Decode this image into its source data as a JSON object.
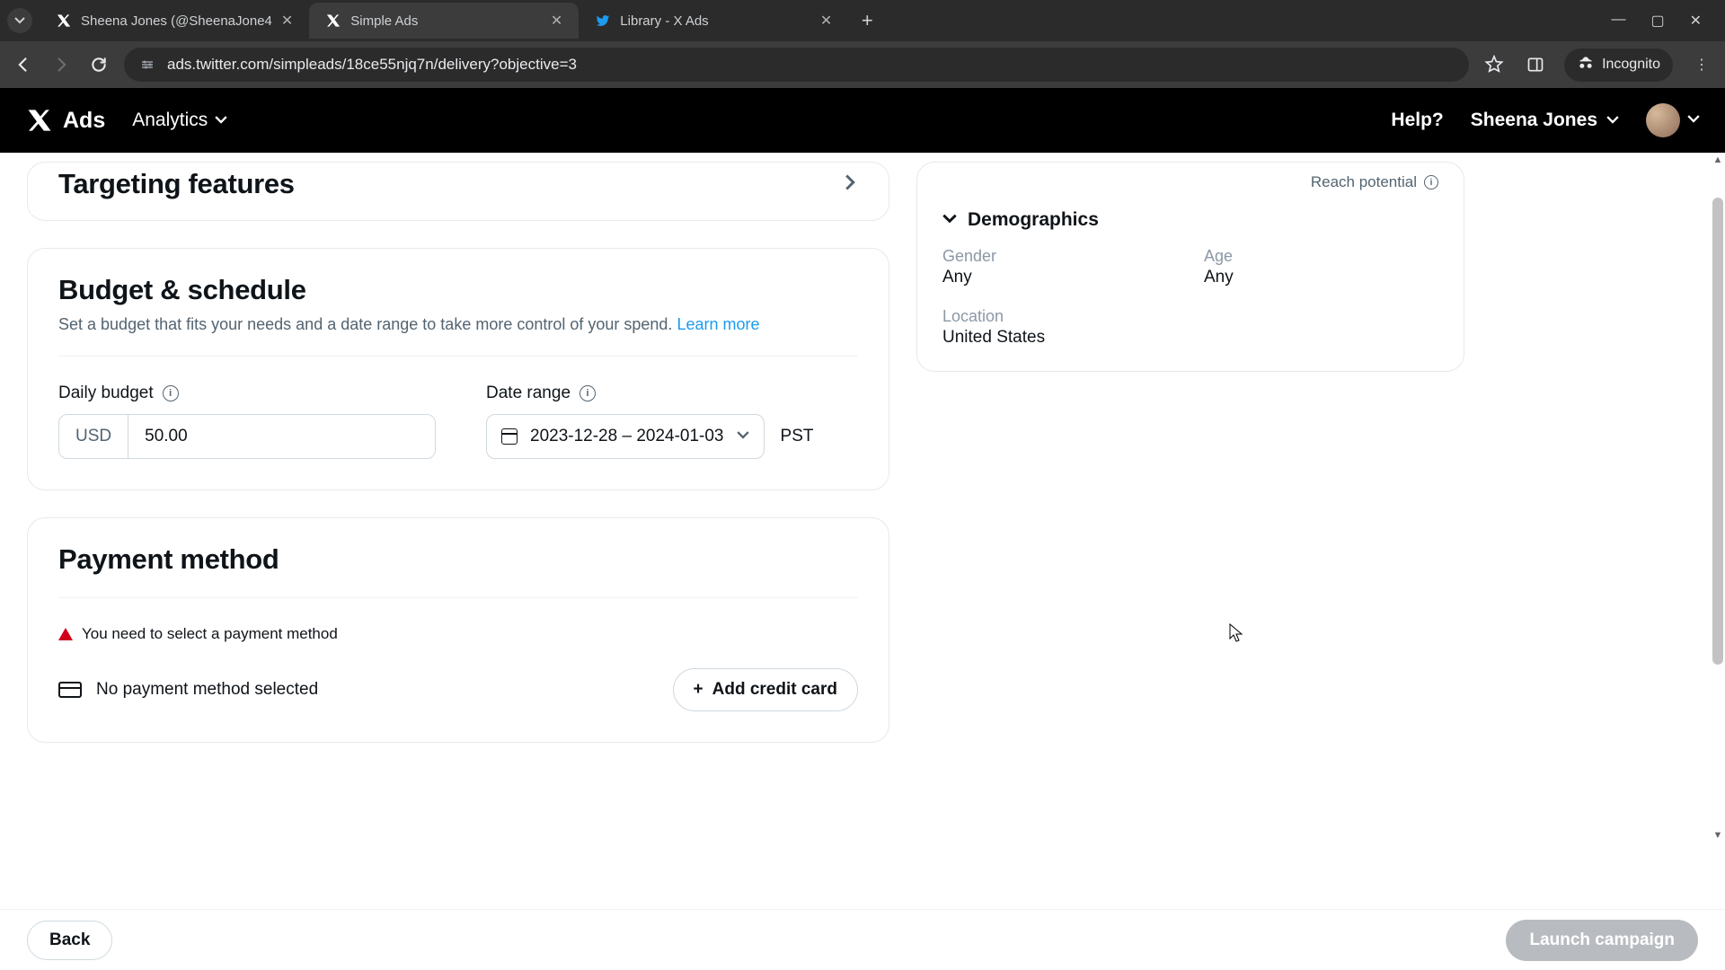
{
  "browser": {
    "tabs": [
      {
        "title": "Sheena Jones (@SheenaJone4"
      },
      {
        "title": "Simple Ads"
      },
      {
        "title": "Library - X Ads"
      }
    ],
    "url": "ads.twitter.com/simpleads/18ce55njq7n/delivery?objective=3",
    "incognito": "Incognito"
  },
  "app": {
    "product": "Ads",
    "nav_analytics": "Analytics",
    "help": "Help?",
    "user_name": "Sheena Jones"
  },
  "main": {
    "targeting_title": "Targeting features",
    "budget": {
      "title": "Budget & schedule",
      "subtitle": "Set a budget that fits your needs and a date range to take more control of your spend. ",
      "learn_more": "Learn more",
      "daily_label": "Daily budget",
      "currency": "USD",
      "daily_value": "50.00",
      "date_label": "Date range",
      "date_value": "2023-12-28 – 2024-01-03",
      "timezone": "PST"
    },
    "payment": {
      "title": "Payment method",
      "alert": "You need to select a payment method",
      "no_method": "No payment method selected",
      "add_card": "Add credit card"
    }
  },
  "side": {
    "reach_label": "Reach potential",
    "demo_title": "Demographics",
    "gender_label": "Gender",
    "gender_value": "Any",
    "age_label": "Age",
    "age_value": "Any",
    "location_label": "Location",
    "location_value": "United States"
  },
  "footer": {
    "back": "Back",
    "launch": "Launch campaign"
  }
}
